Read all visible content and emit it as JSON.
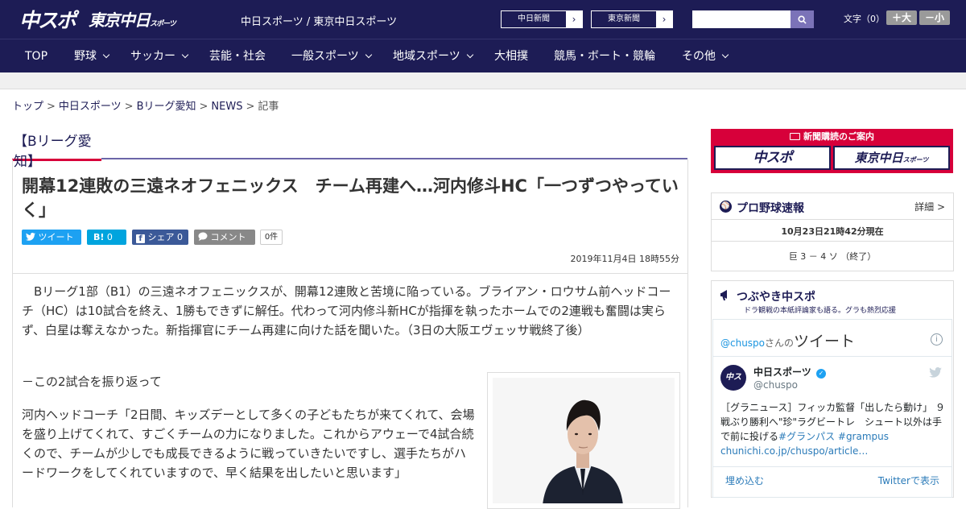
{
  "header": {
    "logo_main": "中スポ",
    "logo_tokyo": "東京中日",
    "logo_tokyo_small": "スポーツ",
    "site_title": "中日スポーツ / 東京中日スポーツ",
    "links": [
      "中日新聞",
      "東京新聞"
    ],
    "font_size_label": "文字（0）",
    "font_plus": "＋大",
    "font_minus": "－小"
  },
  "nav": {
    "items": [
      {
        "label": "TOP",
        "has_sub": false
      },
      {
        "label": "野球",
        "has_sub": true
      },
      {
        "label": "サッカー",
        "has_sub": true
      },
      {
        "label": "芸能・社会",
        "has_sub": false
      },
      {
        "label": "一般スポーツ",
        "has_sub": true
      },
      {
        "label": "地域スポーツ",
        "has_sub": true
      },
      {
        "label": "大相撲",
        "has_sub": false
      },
      {
        "label": "競馬・ボート・競輪",
        "has_sub": false
      },
      {
        "label": "その他",
        "has_sub": true
      }
    ]
  },
  "breadcrumb": [
    "トップ",
    "中日スポーツ",
    "Bリーグ愛知",
    "NEWS",
    "記事"
  ],
  "article": {
    "category": "【Bリーグ愛知】",
    "title": "開幕12連敗の三遠ネオフェニックス　チーム再建へ…河内修斗HC「一つずつやっていく」",
    "share": {
      "tweet": "ツイート",
      "hatena": "0",
      "facebook": "シェア 0",
      "comment": "コメント",
      "comment_count": "0件"
    },
    "date": "2019年11月4日 18時55分",
    "lead": "Bリーグ1部（B1）の三遠ネオフェニックスが、開幕12連敗と苦境に陥っている。ブライアン・ロウサム前ヘッドコーチ（HC）は10試合を終え、1勝もできずに解任。代わって河内修斗新HCが指揮を執ったホームでの2連戦も奮闘は実らず、白星は奪えなかった。新指揮官にチーム再建に向けた話を聞いた。（3日の大阪エヴェッサ戦終了後）",
    "question": "－この2試合を振り返って",
    "answer": "河内ヘッドコーチ「2日間、キッズデーとして多くの子どもたちが来てくれて、会場を盛り上げてくれて、すごくチームの力になりました。これからアウェーで4試合続くので、チームが少しでも成長できるように戦っていきたいですし、選手たちがハードワークをしてくれていますので、早く結果を出したいと思います」"
  },
  "sidebar": {
    "subscribe": {
      "title": "新聞購読のご案内",
      "box1": "中スポ",
      "box2": "東京中日",
      "box2_small": "スポーツ"
    },
    "baseball": {
      "title": "プロ野球速報",
      "detail": "詳細 >",
      "time": "10月23日21時42分現在",
      "score": "巨 3 － 4 ソ （終了）"
    },
    "twitter": {
      "title": "つぶやき中スポ",
      "subtitle": "ドラ観戦の本紙評論家も語る。グラも熱烈応援",
      "handle_link": "@chuspo",
      "handle_suffix": "さんの",
      "tweets_label": "ツイート",
      "user_name": "中日スポーツ",
      "user_handle": "@chuspo",
      "tweet_plain": "［グラニュース］フィッカ監督「出したら動け」 ９戦ぶり勝利へ\"珍\"ラグビートレ　シュート以外は手で前に投げる",
      "tweet_hashtags": "#グランパス #grampus",
      "tweet_link": "chunichi.co.jp/chuspo/article…",
      "embed": "埋め込む",
      "view_on_twitter": "Twitterで表示"
    }
  },
  "colors": {
    "navy": "#1d1c55",
    "accent_red": "#d7003a",
    "twitter_blue": "#1da1f2",
    "hatena_blue": "#00a4de",
    "facebook_blue": "#3b5998"
  }
}
